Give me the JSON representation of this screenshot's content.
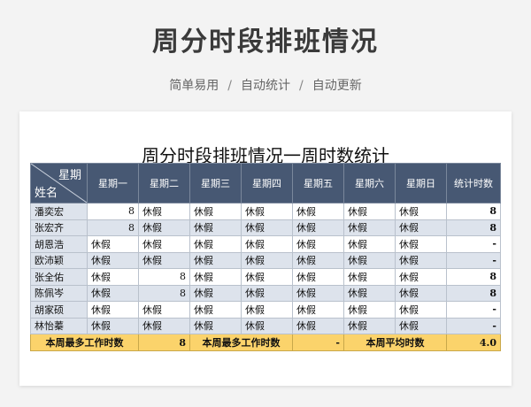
{
  "header": {
    "title": "周分时段排班情况",
    "subtitle_parts": [
      "简单易用",
      "自动统计",
      "自动更新"
    ],
    "separator": "/"
  },
  "sheet": {
    "title": "周分时段排班情况一周时数统计",
    "corner_top": "星期",
    "corner_bottom": "姓名",
    "columns": [
      "星期一",
      "星期二",
      "星期三",
      "星期四",
      "星期五",
      "星期六",
      "星期日",
      "统计时数"
    ],
    "rows": [
      {
        "name": "潘奕宏",
        "cells": [
          "8",
          "休假",
          "休假",
          "休假",
          "休假",
          "休假",
          "休假"
        ],
        "total": "8"
      },
      {
        "name": "张宏齐",
        "cells": [
          "8",
          "休假",
          "休假",
          "休假",
          "休假",
          "休假",
          "休假"
        ],
        "total": "8"
      },
      {
        "name": "胡恩浩",
        "cells": [
          "休假",
          "休假",
          "休假",
          "休假",
          "休假",
          "休假",
          "休假"
        ],
        "total": "-"
      },
      {
        "name": "欧沛颖",
        "cells": [
          "休假",
          "休假",
          "休假",
          "休假",
          "休假",
          "休假",
          "休假"
        ],
        "total": "-"
      },
      {
        "name": "张全佑",
        "cells": [
          "休假",
          "8",
          "休假",
          "休假",
          "休假",
          "休假",
          "休假"
        ],
        "total": "8"
      },
      {
        "name": "陈佩岑",
        "cells": [
          "休假",
          "8",
          "休假",
          "休假",
          "休假",
          "休假",
          "休假"
        ],
        "total": "8"
      },
      {
        "name": "胡家硕",
        "cells": [
          "休假",
          "休假",
          "休假",
          "休假",
          "休假",
          "休假",
          "休假"
        ],
        "total": "-"
      },
      {
        "name": "林怡蓁",
        "cells": [
          "休假",
          "休假",
          "休假",
          "休假",
          "休假",
          "休假",
          "休假"
        ],
        "total": "-"
      }
    ],
    "footer": {
      "label1": "本周最多工作时数",
      "value1": "8",
      "label2": "本周最多工作时数",
      "value2": "-",
      "label3": "本周平均时数",
      "value3": "4.0"
    }
  },
  "colors": {
    "header_bg": "#475873",
    "alt_row": "#dde3ec",
    "footer_bg": "#fbd36b"
  }
}
